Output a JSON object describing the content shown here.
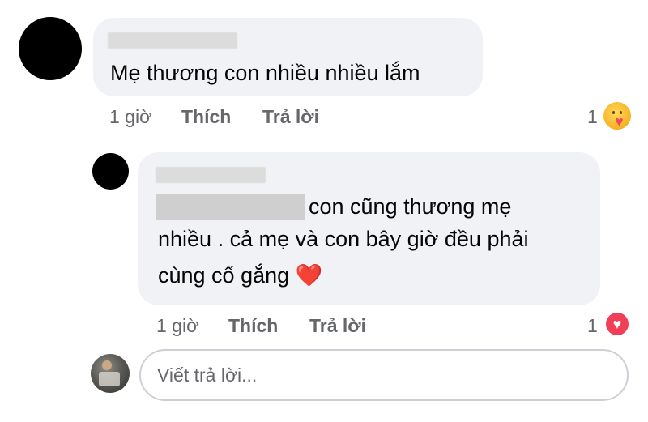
{
  "comment": {
    "text": "Mẹ thương con nhiều nhiều lắm",
    "time": "1 giờ",
    "like_label": "Thích",
    "reply_label": "Trả lời",
    "reaction_count": "1",
    "reaction_icon": "care-icon"
  },
  "reply": {
    "line1_suffix": "con cũng thương mẹ",
    "line2": "nhiều . cả mẹ và con bây giờ đều phải",
    "line3_text": "cùng cố gắng",
    "line3_emoji": "❤️",
    "time": "1 giờ",
    "like_label": "Thích",
    "reply_label": "Trả lời",
    "reaction_count": "1",
    "reaction_icon": "love-icon"
  },
  "composer": {
    "placeholder": "Viết trả lời..."
  },
  "colors": {
    "bubble": "#f0f2f5",
    "meta_text": "#65676b",
    "love": "#f33e58",
    "care": "#f7b125"
  }
}
